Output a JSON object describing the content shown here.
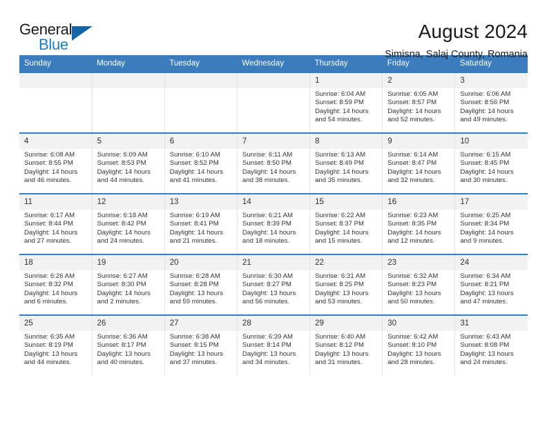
{
  "brand": {
    "name_top": "General",
    "name_bottom": "Blue",
    "triangle_color": "#1565a8",
    "blue_color": "#1f7bc1"
  },
  "header": {
    "title": "August 2024",
    "subtitle": "Simisna, Salaj County, Romania"
  },
  "theme": {
    "header_bg": "#3a7cbe",
    "daynum_bg": "#f1f1f1",
    "grid_line": "#e3e3e3"
  },
  "weekday_headers": [
    "Sunday",
    "Monday",
    "Tuesday",
    "Wednesday",
    "Thursday",
    "Friday",
    "Saturday"
  ],
  "labels": {
    "sunrise_prefix": "Sunrise:",
    "sunset_prefix": "Sunset:",
    "daylight_prefix": "Daylight:"
  },
  "weeks": [
    [
      {
        "day": "",
        "empty": true,
        "line1": "",
        "line2": "",
        "line3": "",
        "line4": ""
      },
      {
        "day": "",
        "empty": true,
        "line1": "",
        "line2": "",
        "line3": "",
        "line4": ""
      },
      {
        "day": "",
        "empty": true,
        "line1": "",
        "line2": "",
        "line3": "",
        "line4": ""
      },
      {
        "day": "",
        "empty": true,
        "line1": "",
        "line2": "",
        "line3": "",
        "line4": ""
      },
      {
        "day": "1",
        "empty": false,
        "line1": "Sunrise: 6:04 AM",
        "line2": "Sunset: 8:59 PM",
        "line3": "Daylight: 14 hours",
        "line4": "and 54 minutes."
      },
      {
        "day": "2",
        "empty": false,
        "line1": "Sunrise: 6:05 AM",
        "line2": "Sunset: 8:57 PM",
        "line3": "Daylight: 14 hours",
        "line4": "and 52 minutes."
      },
      {
        "day": "3",
        "empty": false,
        "line1": "Sunrise: 6:06 AM",
        "line2": "Sunset: 8:56 PM",
        "line3": "Daylight: 14 hours",
        "line4": "and 49 minutes."
      }
    ],
    [
      {
        "day": "4",
        "empty": false,
        "line1": "Sunrise: 6:08 AM",
        "line2": "Sunset: 8:55 PM",
        "line3": "Daylight: 14 hours",
        "line4": "and 46 minutes."
      },
      {
        "day": "5",
        "empty": false,
        "line1": "Sunrise: 6:09 AM",
        "line2": "Sunset: 8:53 PM",
        "line3": "Daylight: 14 hours",
        "line4": "and 44 minutes."
      },
      {
        "day": "6",
        "empty": false,
        "line1": "Sunrise: 6:10 AM",
        "line2": "Sunset: 8:52 PM",
        "line3": "Daylight: 14 hours",
        "line4": "and 41 minutes."
      },
      {
        "day": "7",
        "empty": false,
        "line1": "Sunrise: 6:11 AM",
        "line2": "Sunset: 8:50 PM",
        "line3": "Daylight: 14 hours",
        "line4": "and 38 minutes."
      },
      {
        "day": "8",
        "empty": false,
        "line1": "Sunrise: 6:13 AM",
        "line2": "Sunset: 8:49 PM",
        "line3": "Daylight: 14 hours",
        "line4": "and 35 minutes."
      },
      {
        "day": "9",
        "empty": false,
        "line1": "Sunrise: 6:14 AM",
        "line2": "Sunset: 8:47 PM",
        "line3": "Daylight: 14 hours",
        "line4": "and 32 minutes."
      },
      {
        "day": "10",
        "empty": false,
        "line1": "Sunrise: 6:15 AM",
        "line2": "Sunset: 8:45 PM",
        "line3": "Daylight: 14 hours",
        "line4": "and 30 minutes."
      }
    ],
    [
      {
        "day": "11",
        "empty": false,
        "line1": "Sunrise: 6:17 AM",
        "line2": "Sunset: 8:44 PM",
        "line3": "Daylight: 14 hours",
        "line4": "and 27 minutes."
      },
      {
        "day": "12",
        "empty": false,
        "line1": "Sunrise: 6:18 AM",
        "line2": "Sunset: 8:42 PM",
        "line3": "Daylight: 14 hours",
        "line4": "and 24 minutes."
      },
      {
        "day": "13",
        "empty": false,
        "line1": "Sunrise: 6:19 AM",
        "line2": "Sunset: 8:41 PM",
        "line3": "Daylight: 14 hours",
        "line4": "and 21 minutes."
      },
      {
        "day": "14",
        "empty": false,
        "line1": "Sunrise: 6:21 AM",
        "line2": "Sunset: 8:39 PM",
        "line3": "Daylight: 14 hours",
        "line4": "and 18 minutes."
      },
      {
        "day": "15",
        "empty": false,
        "line1": "Sunrise: 6:22 AM",
        "line2": "Sunset: 8:37 PM",
        "line3": "Daylight: 14 hours",
        "line4": "and 15 minutes."
      },
      {
        "day": "16",
        "empty": false,
        "line1": "Sunrise: 6:23 AM",
        "line2": "Sunset: 8:35 PM",
        "line3": "Daylight: 14 hours",
        "line4": "and 12 minutes."
      },
      {
        "day": "17",
        "empty": false,
        "line1": "Sunrise: 6:25 AM",
        "line2": "Sunset: 8:34 PM",
        "line3": "Daylight: 14 hours",
        "line4": "and 9 minutes."
      }
    ],
    [
      {
        "day": "18",
        "empty": false,
        "line1": "Sunrise: 6:26 AM",
        "line2": "Sunset: 8:32 PM",
        "line3": "Daylight: 14 hours",
        "line4": "and 6 minutes."
      },
      {
        "day": "19",
        "empty": false,
        "line1": "Sunrise: 6:27 AM",
        "line2": "Sunset: 8:30 PM",
        "line3": "Daylight: 14 hours",
        "line4": "and 2 minutes."
      },
      {
        "day": "20",
        "empty": false,
        "line1": "Sunrise: 6:28 AM",
        "line2": "Sunset: 8:28 PM",
        "line3": "Daylight: 13 hours",
        "line4": "and 59 minutes."
      },
      {
        "day": "21",
        "empty": false,
        "line1": "Sunrise: 6:30 AM",
        "line2": "Sunset: 8:27 PM",
        "line3": "Daylight: 13 hours",
        "line4": "and 56 minutes."
      },
      {
        "day": "22",
        "empty": false,
        "line1": "Sunrise: 6:31 AM",
        "line2": "Sunset: 8:25 PM",
        "line3": "Daylight: 13 hours",
        "line4": "and 53 minutes."
      },
      {
        "day": "23",
        "empty": false,
        "line1": "Sunrise: 6:32 AM",
        "line2": "Sunset: 8:23 PM",
        "line3": "Daylight: 13 hours",
        "line4": "and 50 minutes."
      },
      {
        "day": "24",
        "empty": false,
        "line1": "Sunrise: 6:34 AM",
        "line2": "Sunset: 8:21 PM",
        "line3": "Daylight: 13 hours",
        "line4": "and 47 minutes."
      }
    ],
    [
      {
        "day": "25",
        "empty": false,
        "line1": "Sunrise: 6:35 AM",
        "line2": "Sunset: 8:19 PM",
        "line3": "Daylight: 13 hours",
        "line4": "and 44 minutes."
      },
      {
        "day": "26",
        "empty": false,
        "line1": "Sunrise: 6:36 AM",
        "line2": "Sunset: 8:17 PM",
        "line3": "Daylight: 13 hours",
        "line4": "and 40 minutes."
      },
      {
        "day": "27",
        "empty": false,
        "line1": "Sunrise: 6:38 AM",
        "line2": "Sunset: 8:15 PM",
        "line3": "Daylight: 13 hours",
        "line4": "and 37 minutes."
      },
      {
        "day": "28",
        "empty": false,
        "line1": "Sunrise: 6:39 AM",
        "line2": "Sunset: 8:14 PM",
        "line3": "Daylight: 13 hours",
        "line4": "and 34 minutes."
      },
      {
        "day": "29",
        "empty": false,
        "line1": "Sunrise: 6:40 AM",
        "line2": "Sunset: 8:12 PM",
        "line3": "Daylight: 13 hours",
        "line4": "and 31 minutes."
      },
      {
        "day": "30",
        "empty": false,
        "line1": "Sunrise: 6:42 AM",
        "line2": "Sunset: 8:10 PM",
        "line3": "Daylight: 13 hours",
        "line4": "and 28 minutes."
      },
      {
        "day": "31",
        "empty": false,
        "line1": "Sunrise: 6:43 AM",
        "line2": "Sunset: 8:08 PM",
        "line3": "Daylight: 13 hours",
        "line4": "and 24 minutes."
      }
    ]
  ]
}
